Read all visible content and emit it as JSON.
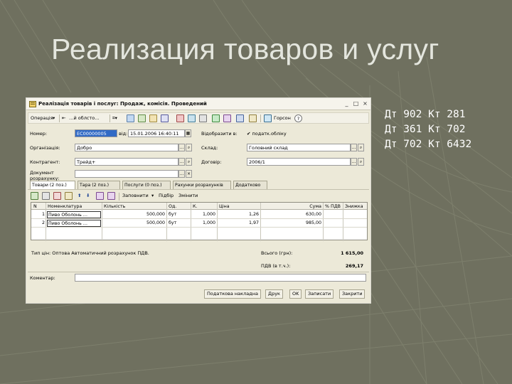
{
  "slide": {
    "title": "Реализация товаров и услуг",
    "entries": [
      "Дт 902 Кт 281",
      "Дт 361 Кт 702",
      "Дт 702 Кт 6432"
    ]
  },
  "window": {
    "title": "Реалізація товарів і послуг: Продаж, комісія. Проведений",
    "controls": [
      "_",
      "□",
      "×"
    ]
  },
  "toolbar": {
    "operation_label": "Операція",
    "operation_menu_label": "…й облсто…",
    "help_label": "Горсон"
  },
  "form": {
    "number_label": "Номер:",
    "number_value": "ЕС00000005",
    "date_label": "від:",
    "date_value": "15.01.2006 16:40:11",
    "reflect_label": "Відобразити в:",
    "reflect_value": "✔ податк.обліку",
    "org_label": "Організація:",
    "org_value": "Добро",
    "warehouse_label": "Склад:",
    "warehouse_value": "Головний склад",
    "contractor_label": "Контрагент:",
    "contractor_value": "Трейд+",
    "contract_label": "Договір:",
    "contract_value": "2006/1",
    "settlement_label": "Документ розрахунку:"
  },
  "tabs": [
    "Товари (2 поз.)",
    "Тара (2 поз.)",
    "Послуги (0 поз.)",
    "Рахунки розрахунків",
    "Додатково"
  ],
  "subtoolbar": {
    "fill_label": "Заповнити",
    "select_label": "Підбір",
    "change_label": "Змінити"
  },
  "table": {
    "columns": [
      "N",
      "Номенклатура",
      "Кількість",
      "Од.",
      "К.",
      "Ціна",
      "Сума",
      "% ПДВ",
      "Знижка"
    ],
    "rows": [
      {
        "n": "1",
        "item": "Пиво Оболонь …",
        "qty": "500,000",
        "unit": "бут",
        "k": "1,000",
        "price": "1,26",
        "sum": "630,00"
      },
      {
        "n": "2",
        "item": "Пиво Оболонь …",
        "qty": "500,000",
        "unit": "бут",
        "k": "1,000",
        "price": "1,97",
        "sum": "985,00"
      }
    ]
  },
  "totals": {
    "price_type_label": "Тип цін: Оптова Автоматичний розрахунок ПДВ.",
    "total_label": "Всього (грн):",
    "total_value": "1 615,00",
    "vat_label": "ПДВ (в т.ч.):",
    "vat_value": "269,17"
  },
  "comment_label": "Коментар:",
  "bottom_buttons": [
    "Податкова накладна",
    "Друк",
    "OK",
    "Записати",
    "Закрити"
  ],
  "colors": {
    "slide_background": "#6f705f",
    "window_background": "#ece9d8",
    "selection": "#316ac5"
  }
}
